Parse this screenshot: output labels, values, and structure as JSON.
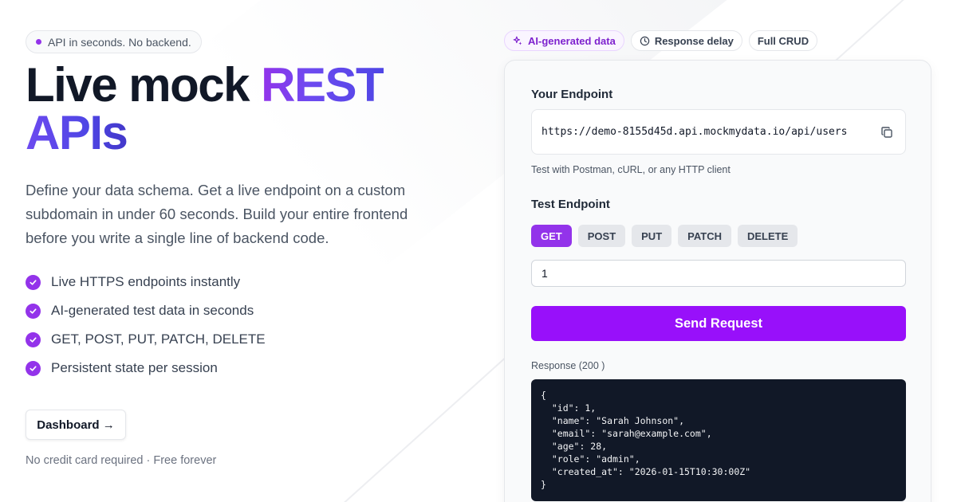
{
  "hero": {
    "badge": "API in seconds. No backend.",
    "title_part1": "Live mock ",
    "title_part2": "REST",
    "title_line2": "APIs",
    "description": "Define your data schema. Get a live endpoint on a custom subdomain in under 60 seconds. Build your entire frontend before you write a single line of backend code.",
    "features": [
      "Live HTTPS endpoints instantly",
      "AI-generated test data in seconds",
      "GET, POST, PUT, PATCH, DELETE",
      "Persistent state per session"
    ],
    "cta_label": "Dashboard →",
    "note": "No credit card required · Free forever"
  },
  "tags": {
    "ai": "AI-generated data",
    "delay": "Response delay",
    "crud": "Full CRUD"
  },
  "card": {
    "endpoint_label": "Your Endpoint",
    "endpoint_url": "https://demo-8155d45d.api.mockmydata.io/api/users",
    "endpoint_hint": "Test with Postman, cURL, or any HTTP client",
    "test_label": "Test Endpoint",
    "methods": [
      "GET",
      "POST",
      "PUT",
      "PATCH",
      "DELETE"
    ],
    "active_method": "GET",
    "id_value": "1",
    "send_label": "Send Request",
    "response_label": "Response (200 )",
    "response_body": "{\n  \"id\": 1,\n  \"name\": \"Sarah Johnson\",\n  \"email\": \"sarah@example.com\",\n  \"age\": 28,\n  \"role\": \"admin\",\n  \"created_at\": \"2026-01-15T10:30:00Z\"\n}"
  },
  "colors": {
    "accent": "#9333ea",
    "button": "#9810fa",
    "response_bg": "#111827"
  },
  "icons": {
    "badge_dot": "dot-icon",
    "feature_check": "check-circle-icon",
    "ai_tag": "sparkles-icon",
    "delay_tag": "clock-icon",
    "copy": "copy-icon"
  }
}
